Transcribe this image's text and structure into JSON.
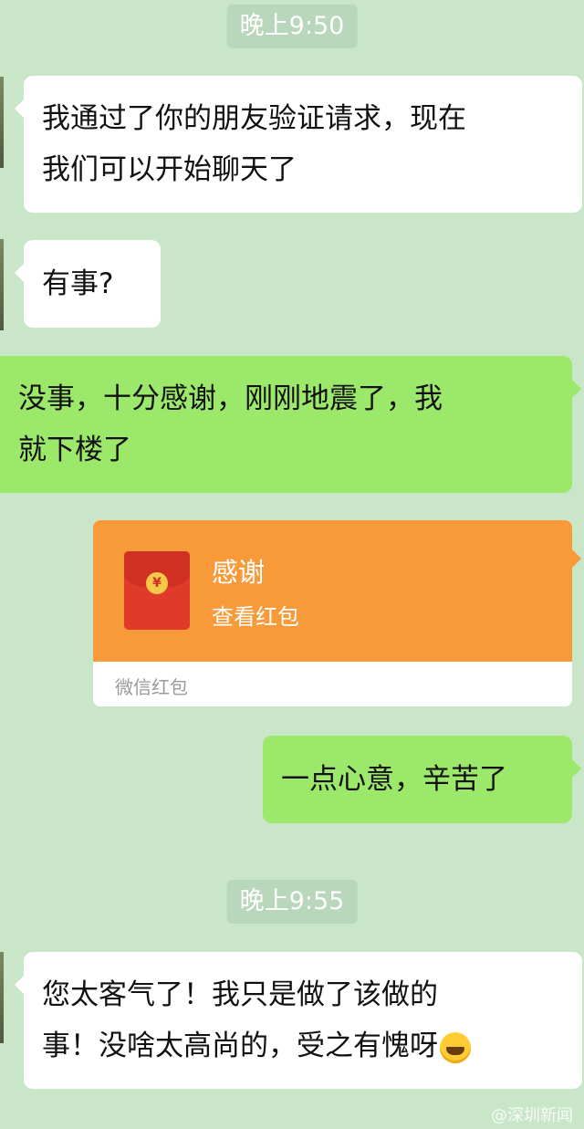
{
  "timestamps": [
    "晚上9:50",
    "晚上9:55"
  ],
  "messages": [
    {
      "side": "in",
      "lines": [
        "我通过了你的朋友验证请求，现在",
        "我们可以开始聊天了"
      ]
    },
    {
      "side": "in",
      "lines": [
        "有事?"
      ]
    },
    {
      "side": "out",
      "lines": [
        "没事，十分感谢，刚刚地震了，我",
        "就下楼了"
      ]
    },
    {
      "side": "out",
      "lines": [
        "一点心意，辛苦了"
      ]
    },
    {
      "side": "in",
      "lines": [
        "您太客气了！我只是做了该做的",
        "事！没啥太高尚的，受之有愧呀"
      ]
    }
  ],
  "red_packet": {
    "title": "感谢",
    "subtitle": "查看红包",
    "footer": "微信红包",
    "coin_symbol": "¥",
    "color": "#f89a3a"
  },
  "emoji": {
    "name": "crying-laughing-emoji"
  },
  "watermark": "@深圳新闻",
  "colors": {
    "background": "#c9e6c9",
    "incoming": "#ffffff",
    "outgoing": "#9be86a"
  }
}
